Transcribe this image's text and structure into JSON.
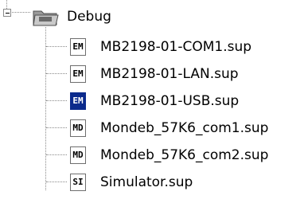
{
  "tree": {
    "root": {
      "label": "Debug",
      "expanded": true,
      "icon": "folder-icon"
    },
    "items": [
      {
        "label": "MB2198-01-COM1.sup",
        "badge": "EM",
        "icon": "sup-file-icon"
      },
      {
        "label": "MB2198-01-LAN.sup",
        "badge": "EM",
        "icon": "sup-file-icon"
      },
      {
        "label": "MB2198-01-USB.sup",
        "badge": "EM",
        "icon": "sup-file-icon",
        "selected": true
      },
      {
        "label": "Mondeb_57K6_com1.sup",
        "badge": "MD",
        "icon": "sup-file-icon"
      },
      {
        "label": "Mondeb_57K6_com2.sup",
        "badge": "MD",
        "icon": "sup-file-icon"
      },
      {
        "label": "Simulator.sup",
        "badge": "SI",
        "icon": "sup-file-icon"
      }
    ]
  },
  "colors": {
    "selected_icon_bg": "#0b2a8c",
    "connector": "#8a8a8a"
  }
}
